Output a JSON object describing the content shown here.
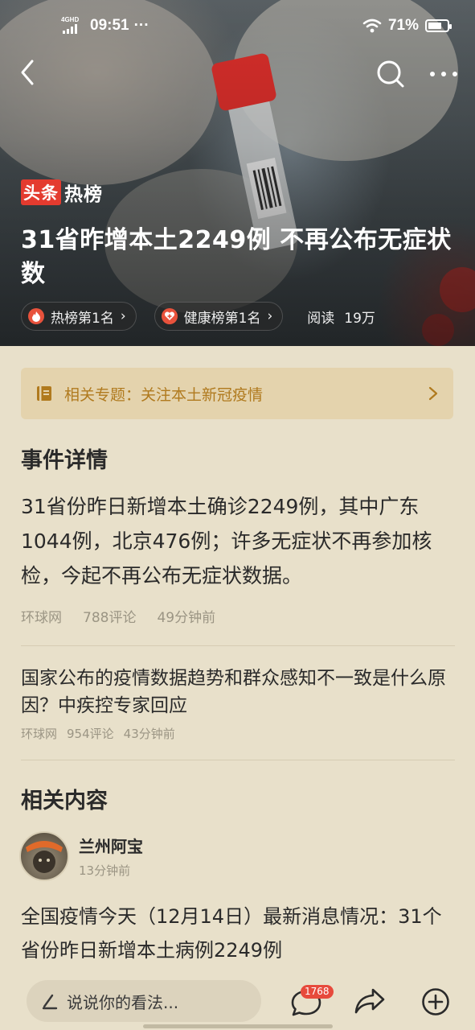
{
  "status_bar": {
    "network": "4GHD",
    "time": "09:51",
    "overflow_dots": "···",
    "battery_percent": "71%",
    "battery_level": 0.71
  },
  "header": {
    "badge_red": "头条",
    "badge_text": "热榜",
    "title": "31省昨增本土2249例  不再公布无症状数",
    "tags": [
      {
        "label": "热榜第1名",
        "icon": "flame-icon",
        "color": "#e8523c"
      },
      {
        "label": "健康榜第1名",
        "icon": "heart-plus-icon",
        "color": "#e8523c"
      }
    ],
    "read_label": "阅读",
    "read_count": "19万"
  },
  "topic": {
    "label": "相关专题：关注本土新冠疫情",
    "icon": "book-icon"
  },
  "event": {
    "section_title": "事件详情",
    "text": "31省份昨日新增本土确诊2249例，其中广东1044例，北京476例；许多无症状不再参加核检，今起不再公布无症状数据。",
    "source": "环球网",
    "comments": "788评论",
    "time": "49分钟前"
  },
  "related_link": {
    "title": "国家公布的疫情数据趋势和群众感知不一致是什么原因？中疾控专家回应",
    "source": "环球网",
    "comments": "954评论",
    "time": "43分钟前"
  },
  "related": {
    "section_title": "相关内容",
    "author_name": "兰州阿宝",
    "author_time": "13分钟前",
    "post_text": "全国疫情今天（12月14日）最新消息情况：31个省份昨日新增本土病例2249例"
  },
  "bottom_bar": {
    "input_placeholder": "说说你的看法...",
    "comment_count": "1768"
  },
  "colors": {
    "accent_red": "#e43b2f",
    "topic_text": "#b07a1e",
    "background": "#e8e0ca"
  }
}
